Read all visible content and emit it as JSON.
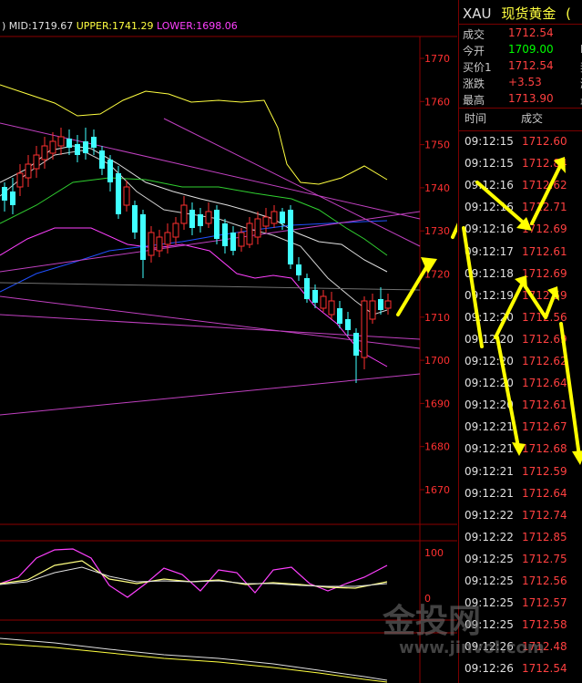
{
  "header": {
    "paren": ")",
    "mid": "MID:1719.67",
    "upper": "UPPER:1741.29",
    "lower": "LOWER:1698.06",
    "mid_color": "#e0e0e0",
    "upper_color": "#ffff40",
    "lower_color": "#ff40ff"
  },
  "price_axis": [
    "1770",
    "1760",
    "1750",
    "1740",
    "1730",
    "1720",
    "1710",
    "1700",
    "1690",
    "1680",
    "1670"
  ],
  "osc_axis": [
    "100",
    "0"
  ],
  "quote": {
    "symbol": "XAU",
    "name": "现货黄金",
    "extra": "(",
    "fields": [
      {
        "label": "成交",
        "value": "1712.54",
        "color": "#ff4040",
        "cut": ""
      },
      {
        "label": "今开",
        "value": "1709.00",
        "color": "#00ff00",
        "cut": "E"
      },
      {
        "label": "买价1",
        "value": "1712.54",
        "color": "#ff4040",
        "cut": "妻"
      },
      {
        "label": "涨跌",
        "value": "+3.53",
        "color": "#ff4040",
        "cut": "涨"
      },
      {
        "label": "最高",
        "value": "1713.90",
        "color": "#ff4040",
        "cut": "最"
      }
    ],
    "tick_headers": {
      "time": "时间",
      "price": "成交"
    },
    "ticks": [
      {
        "time": "09:12:15",
        "price": "1712.60"
      },
      {
        "time": "09:12:15",
        "price": "1712.84"
      },
      {
        "time": "09:12:16",
        "price": "1712.62"
      },
      {
        "time": "09:12:16",
        "price": "1712.71"
      },
      {
        "time": "09:12:16",
        "price": "1712.69"
      },
      {
        "time": "09:12:17",
        "price": "1712.61"
      },
      {
        "time": "09:12:18",
        "price": "1712.69"
      },
      {
        "time": "09:12:19",
        "price": "1712.59"
      },
      {
        "time": "09:12:20",
        "price": "1712.56"
      },
      {
        "time": "09:12:20",
        "price": "1712.69"
      },
      {
        "time": "09:12:20",
        "price": "1712.62"
      },
      {
        "time": "09:12:20",
        "price": "1712.64"
      },
      {
        "time": "09:12:20",
        "price": "1712.61"
      },
      {
        "time": "09:12:21",
        "price": "1712.67"
      },
      {
        "time": "09:12:21",
        "price": "1712.68"
      },
      {
        "time": "09:12:21",
        "price": "1712.59"
      },
      {
        "time": "09:12:21",
        "price": "1712.64"
      },
      {
        "time": "09:12:22",
        "price": "1712.74"
      },
      {
        "time": "09:12:22",
        "price": "1712.85"
      },
      {
        "time": "09:12:25",
        "price": "1712.75"
      },
      {
        "time": "09:12:25",
        "price": "1712.56"
      },
      {
        "time": "09:12:25",
        "price": "1712.57"
      },
      {
        "time": "09:12:25",
        "price": "1712.58"
      },
      {
        "time": "09:12:26",
        "price": "1712.48"
      },
      {
        "time": "09:12:26",
        "price": "1712.54"
      }
    ]
  },
  "watermark": {
    "text": "金投网",
    "url": "www.jinvol.com"
  },
  "colors": {
    "up": "#ff3030",
    "down": "#40ffff",
    "grid": "#8b0000",
    "axis_text": "#ff3030"
  }
}
